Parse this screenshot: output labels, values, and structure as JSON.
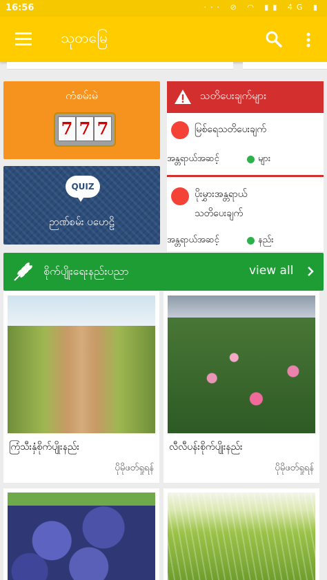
{
  "status_bar": {
    "time": "16:56",
    "network": "4G"
  },
  "app_bar": {
    "title": "သုတမြေ"
  },
  "cards": {
    "game": {
      "label": "ကံစမ်းမဲ",
      "reels": [
        "7",
        "7",
        "7"
      ]
    },
    "quiz": {
      "badge": "QUIZ",
      "label": "ဉာဏ်စမ်း ပဟေဠိ"
    }
  },
  "alerts": {
    "header": "သတိပေးချက်များ",
    "items": [
      {
        "text_lines": [
          "မြစ်ရေသတိပေးချက်"
        ],
        "priority_label": "အန္တရာယ်အဆင့်",
        "priority_value": "များ"
      },
      {
        "text_lines": [
          "ပိုးမွှားအန္တရာယ်",
          "သတိပေးချက်"
        ],
        "priority_label": "အန္တရာယ်အဆင့်",
        "priority_value": "နည်း"
      }
    ]
  },
  "section": {
    "title": "စိုက်ပျိုးရေးနည်းပညာ",
    "view_all": "view all"
  },
  "posts": [
    {
      "title": "ကြံသီးနှံစိုက်ပျိုးနည်း",
      "source": "ပိုမိုဖတ်ရှုရန်"
    },
    {
      "title": "လီလီပန်းစိုက်ပျိုးနည်း",
      "source": "ပိုမိုဖတ်ရှုရန်"
    },
    {
      "title": "",
      "source": ""
    },
    {
      "title": "",
      "source": ""
    }
  ],
  "colors": {
    "app_bar": "#ffcc00",
    "game_card": "#f6921e",
    "quiz_card": "#2c4d7a",
    "alert_header": "#d32f2f",
    "danger_dot": "#f44336",
    "ok_dot": "#2bb34a",
    "section_bar": "#1e9d34"
  }
}
